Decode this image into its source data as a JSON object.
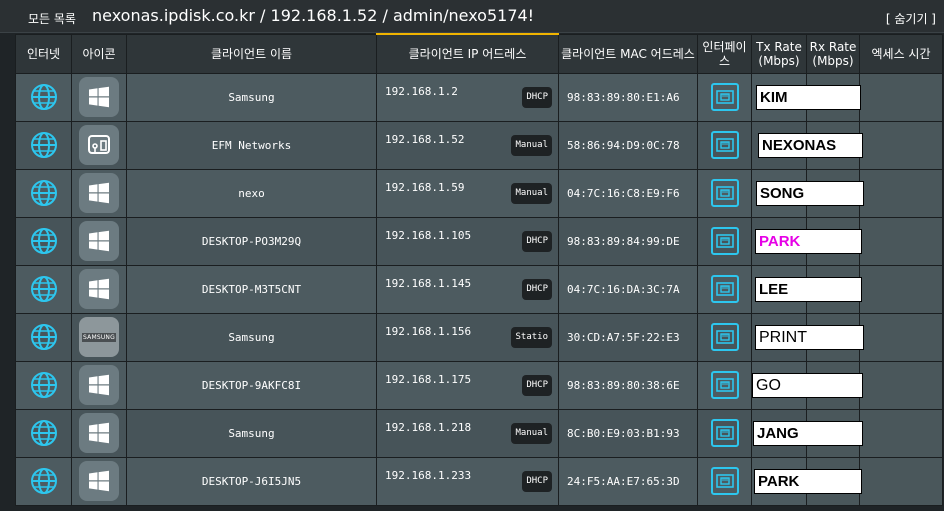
{
  "topbar": {
    "all_list_label": "모든 목록",
    "path": "nexonas.ipdisk.co.kr  /  192.168.1.52  /  admin/nexo5174!",
    "hide_button": "[ 숨기기 ]"
  },
  "headers": {
    "internet": "인터넷",
    "icon": "아이콘",
    "client_name": "클라이언트 이름",
    "client_ip": "클라이언트 IP 어드레스",
    "client_mac": "클라이언트 MAC 어드레스",
    "interface": "인터페이스",
    "tx_rate": "Tx Rate (Mbps)",
    "rx_rate": "Rx Rate (Mbps)",
    "access_time": "엑세스 시간"
  },
  "rows": [
    {
      "name": "Samsung",
      "ip": "192.168.1.2",
      "type": "DHCP",
      "mac": "98:83:89:80:E1:A6",
      "tx": "KIM",
      "icon": "windows-icon"
    },
    {
      "name": "EFM Networks",
      "ip": "192.168.1.52",
      "type": "Manual",
      "mac": "58:86:94:D9:0C:78",
      "tx": "NEXONAS",
      "icon": "nas-device-icon"
    },
    {
      "name": "nexo",
      "ip": "192.168.1.59",
      "type": "Manual",
      "mac": "04:7C:16:C8:E9:F6",
      "tx": "SONG",
      "icon": "windows-icon"
    },
    {
      "name": "DESKTOP-PO3M29Q",
      "ip": "192.168.1.105",
      "type": "DHCP",
      "mac": "98:83:89:84:99:DE",
      "tx": "PARK",
      "icon": "windows-icon"
    },
    {
      "name": "DESKTOP-M3T5CNT",
      "ip": "192.168.1.145",
      "type": "DHCP",
      "mac": "04:7C:16:DA:3C:7A",
      "tx": "LEE",
      "icon": "windows-icon"
    },
    {
      "name": "Samsung",
      "ip": "192.168.1.156",
      "type": "Statio",
      "mac": "30:CD:A7:5F:22:E3",
      "tx": "PRINT",
      "icon": "samsung-logo-icon",
      "logo_text": "SAMSUNG"
    },
    {
      "name": "DESKTOP-9AKFC8I",
      "ip": "192.168.1.175",
      "type": "DHCP",
      "mac": "98:83:89:80:38:6E",
      "tx": "GO",
      "icon": "windows-icon"
    },
    {
      "name": "Samsung",
      "ip": "192.168.1.218",
      "type": "Manual",
      "mac": "8C:B0:E9:03:B1:93",
      "tx": "JANG",
      "icon": "windows-icon"
    },
    {
      "name": "DESKTOP-J6I5JN5",
      "ip": "192.168.1.233",
      "type": "DHCP",
      "mac": "24:F5:AA:E7:65:3D",
      "tx": "PARK",
      "icon": "windows-icon"
    }
  ],
  "colors": {
    "accent_cyan": "#2dc6ee",
    "sort_indicator": "#f0b400",
    "highlight_magenta": "#e600e6"
  }
}
